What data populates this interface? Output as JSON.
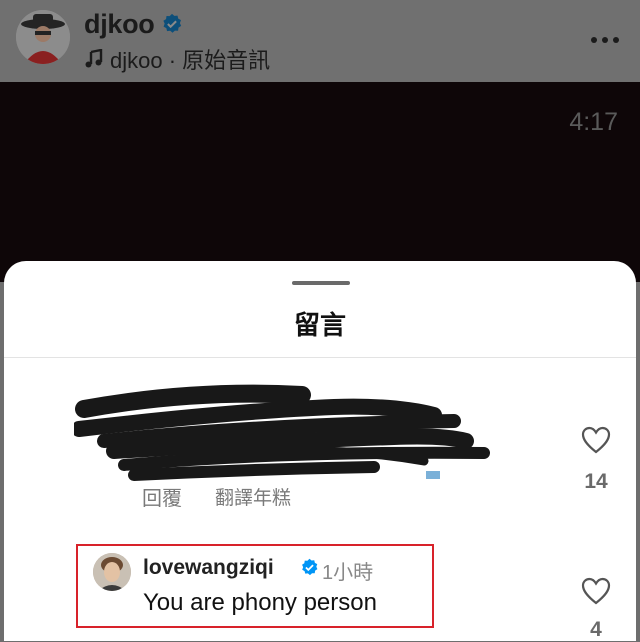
{
  "post": {
    "username": "djkoo",
    "verified": true,
    "audio_label": "djkoo · 原始音訊",
    "more_icon": "ellipsis-icon"
  },
  "video": {
    "time": "4:17"
  },
  "comments_sheet": {
    "title": "留言",
    "comments": [
      {
        "redacted": true,
        "reply_label": "回覆",
        "translate_label": "翻譯年糕",
        "likes": "14"
      },
      {
        "username": "lovewangziqi",
        "verified": true,
        "time": "1小時",
        "text": "You are phony person",
        "likes": "4",
        "highlighted": true,
        "highlight_color": "#d8222a"
      }
    ]
  },
  "colors": {
    "verified_blue": "#0095f6",
    "sheet_bg": "#ffffff",
    "dim_overlay": "#707070"
  }
}
